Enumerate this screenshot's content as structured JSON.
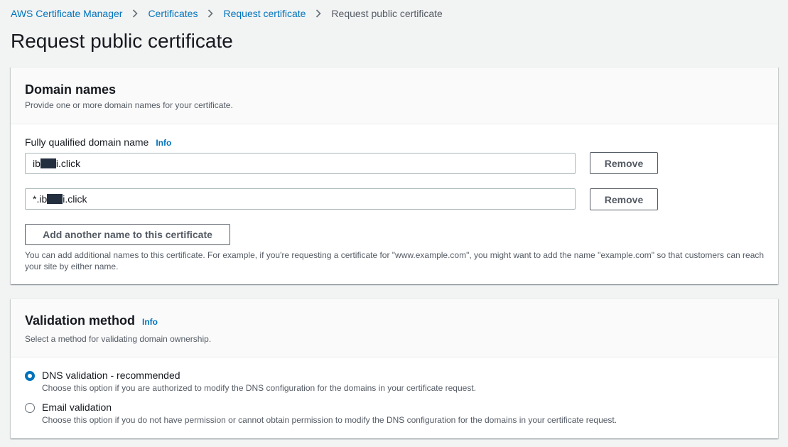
{
  "breadcrumb": {
    "items": [
      "AWS Certificate Manager",
      "Certificates",
      "Request certificate"
    ],
    "current": "Request public certificate"
  },
  "page_title": "Request public certificate",
  "domain_names": {
    "title": "Domain names",
    "description": "Provide one or more domain names for your certificate.",
    "field_label": "Fully qualified domain name",
    "info": "Info",
    "entries": [
      {
        "value_prefix": "ib",
        "value_suffix": "i.click",
        "remove_label": "Remove"
      },
      {
        "value_prefix": "*.ib",
        "value_suffix": "i.click",
        "remove_label": "Remove"
      }
    ],
    "add_button": "Add another name to this certificate",
    "helper": "You can add additional names to this certificate. For example, if you're requesting a certificate for \"www.example.com\", you might want to add the name \"example.com\" so that customers can reach your site by either name."
  },
  "validation": {
    "title": "Validation method",
    "info": "Info",
    "description": "Select a method for validating domain ownership.",
    "options": [
      {
        "label": "DNS validation - recommended",
        "description": "Choose this option if you are authorized to modify the DNS configuration for the domains in your certificate request.",
        "selected": true
      },
      {
        "label": "Email validation",
        "description": "Choose this option if you do not have permission or cannot obtain permission to modify the DNS configuration for the domains in your certificate request.",
        "selected": false
      }
    ]
  },
  "colors": {
    "link": "#0073bb",
    "redaction": "#232f3e",
    "background": "#f2f3f3"
  }
}
